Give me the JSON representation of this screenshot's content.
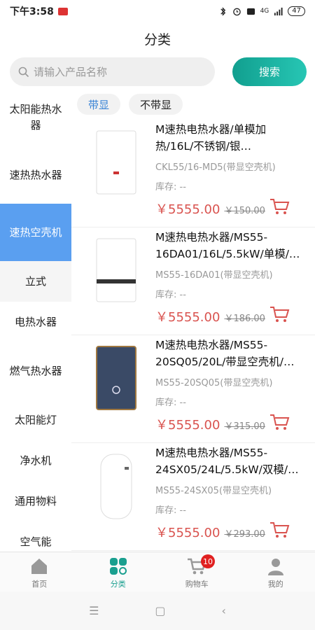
{
  "status_bar": {
    "time": "下午3:58",
    "battery": "47",
    "network": "4G"
  },
  "header": {
    "title": "分类"
  },
  "search": {
    "placeholder": "请输入产品名称",
    "button": "搜索"
  },
  "sidebar": {
    "items": [
      {
        "label": "太阳能热水器",
        "state": "normal"
      },
      {
        "label": "速热热水器",
        "state": "normal"
      },
      {
        "label": "速热空壳机",
        "state": "active"
      },
      {
        "label": "立式",
        "state": "sub"
      },
      {
        "label": "电热水器",
        "state": "normal"
      },
      {
        "label": "燃气热水器",
        "state": "normal"
      },
      {
        "label": "太阳能灯",
        "state": "normal"
      },
      {
        "label": "净水机",
        "state": "normal"
      },
      {
        "label": "通用物料",
        "state": "normal"
      },
      {
        "label": "空气能",
        "state": "normal"
      }
    ]
  },
  "filters": {
    "chips": [
      {
        "label": "带显",
        "active": true
      },
      {
        "label": "不带显",
        "active": false
      }
    ]
  },
  "products": [
    {
      "name": "M速热电热水器/单模加热/16L/不锈钢/银…",
      "code": "CKL55/16-MD5(带显空壳机)",
      "stock": "库存: --",
      "price": "￥5555.00",
      "orig": "￥150.00",
      "thumb_color": "#ffffff"
    },
    {
      "name": "M速热电热水器/MS55-16DA01/16L/5.5kW/单模/…",
      "code": "MS55-16DA01(带显空壳机)",
      "stock": "库存: --",
      "price": "￥5555.00",
      "orig": "￥186.00",
      "thumb_color": "#ffffff"
    },
    {
      "name": "M速热电热水器/MS55-20SQ05/20L/带显空壳机/…",
      "code": "MS55-20SQ05(带显空壳机)",
      "stock": "库存: --",
      "price": "￥5555.00",
      "orig": "￥315.00",
      "thumb_color": "#3a4a66"
    },
    {
      "name": "M速热电热水器/MS55-24SX05/24L/5.5kW/双模/…",
      "code": "MS55-24SX05(带显空壳机)",
      "stock": "库存: --",
      "price": "￥5555.00",
      "orig": "￥293.00",
      "thumb_color": "#ffffff"
    }
  ],
  "bottom_nav": {
    "items": [
      {
        "label": "首页",
        "icon": "home-icon",
        "active": false
      },
      {
        "label": "分类",
        "icon": "category-icon",
        "active": true
      },
      {
        "label": "购物车",
        "icon": "cart-icon",
        "active": false,
        "badge": "10"
      },
      {
        "label": "我的",
        "icon": "profile-icon",
        "active": false
      }
    ]
  },
  "colors": {
    "accent": "#1a9f8f",
    "active_category": "#5a9ff0",
    "price": "#d9534f"
  }
}
